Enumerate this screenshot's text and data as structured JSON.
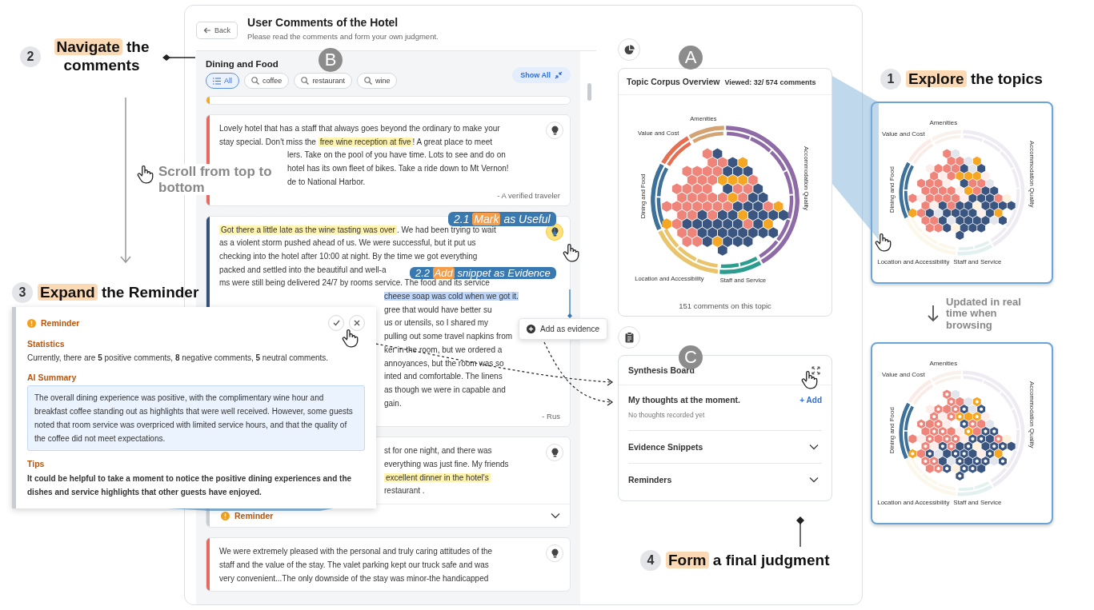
{
  "window": {
    "back_button": "Back",
    "title": "User Comments of the Hotel",
    "subtitle": "Please read the comments and form your own judgment."
  },
  "comments_panel": {
    "marker": "B",
    "title": "Dining and Food",
    "show_all": "Show All",
    "filters": [
      {
        "label": "All",
        "selected": true
      },
      {
        "label": "coffee",
        "selected": false
      },
      {
        "label": "restaurant",
        "selected": false
      },
      {
        "label": "wine",
        "selected": false
      }
    ],
    "comments": [
      {
        "kind": "stub",
        "color": "#f5a623"
      },
      {
        "kind": "comment",
        "color": "#e8695f",
        "useful": false,
        "author": "- A verified traveler",
        "lines": [
          {
            "kind": "full",
            "segments": [
              {
                "text": "Lovely hotel that has a staff that always goes beyond the ordinary to make your"
              }
            ]
          },
          {
            "kind": "full",
            "segments": [
              {
                "text": "stay special. Don't miss the "
              },
              {
                "text": "free wine reception at five",
                "kind": "highlight"
              },
              {
                "text": "! A great place to meet"
              }
            ]
          },
          {
            "kind": "fragment",
            "segments": [
              {
                "text": "lers. Take on the pool of you have time. Lots to see and do on"
              }
            ]
          },
          {
            "kind": "fragment",
            "segments": [
              {
                "text": "hotel has its own fleet of bikes. Take a ride down to Mt Vernon!"
              }
            ]
          },
          {
            "kind": "fragment",
            "segments": [
              {
                "text": "de to National Harbor."
              }
            ]
          }
        ]
      },
      {
        "kind": "comment",
        "color": "#34507c",
        "useful": true,
        "author": "- Rus",
        "lines": [
          {
            "kind": "full",
            "segments": [
              {
                "text": "Got there a little late as the wine tasting was over",
                "kind": "highlight"
              },
              {
                "text": ". We had been trying to wait"
              }
            ]
          },
          {
            "kind": "full",
            "segments": [
              {
                "text": "as a violent storm pushed ahead of us. We were successful, but it put us"
              }
            ]
          },
          {
            "kind": "full",
            "segments": [
              {
                "text": "checking into the hotel after 10:00 at night. By the time we got everything"
              }
            ]
          },
          {
            "kind": "full",
            "segments": [
              {
                "text": "packed and settled into the beautiful and well-a"
              }
            ]
          },
          {
            "kind": "full",
            "segments": [
              {
                "text": "ms were still being delivered 24/7 by rooms service. The food and its service"
              }
            ]
          },
          {
            "kind": "fragment",
            "segments": [
              {
                "text": "cheese soap was cold when we got it.",
                "kind": "selection"
              }
            ]
          },
          {
            "kind": "fragment",
            "segments": [
              {
                "text": "gree that would have better su"
              }
            ]
          },
          {
            "kind": "fragment",
            "segments": [
              {
                "text": "us or utensils, so I shared my"
              }
            ]
          },
          {
            "kind": "fragment",
            "segments": [
              {
                "text": "pulling out some travel napkins from"
              }
            ]
          },
          {
            "kind": "fragment",
            "segments": [
              {
                "text": "ker in the room, but we ordered a"
              }
            ]
          },
          {
            "kind": "fragment",
            "segments": [
              {
                "text": "annoyances, but the room was so"
              }
            ]
          },
          {
            "kind": "fragment",
            "segments": [
              {
                "text": "inted and comfortable. The linens"
              }
            ]
          },
          {
            "kind": "fragment",
            "segments": [
              {
                "text": "as though we were in capable and"
              }
            ]
          },
          {
            "kind": "fragment",
            "segments": [
              {
                "text": "gain."
              }
            ]
          }
        ]
      },
      {
        "kind": "comment",
        "useful": false,
        "reminder": {
          "label": "Reminder",
          "expanded": false
        },
        "lines": [
          {
            "kind": "fragment",
            "segments": [
              {
                "text": "st for one night, and there was"
              }
            ]
          },
          {
            "kind": "fragment",
            "segments": [
              {
                "text": "everything was just fine. My friends"
              }
            ]
          },
          {
            "kind": "fragment",
            "segments": [
              {
                "text": "excellent dinner in the hotel's",
                "kind": "highlight"
              }
            ]
          },
          {
            "kind": "fragment",
            "segments": [
              {
                "text": "restaurant ."
              }
            ]
          }
        ]
      },
      {
        "kind": "comment",
        "color": "#e8695f",
        "useful": false,
        "lines": [
          {
            "kind": "full",
            "segments": [
              {
                "text": "We were extremely pleased with the personal and truly caring attitudes of the"
              }
            ]
          },
          {
            "kind": "full",
            "segments": [
              {
                "text": "staff and the value of the stay. The valet parking kept our truck safe and was"
              }
            ]
          },
          {
            "kind": "full",
            "segments": [
              {
                "text": "very convenient...The only downside of the stay was minor-the handicapped"
              }
            ]
          }
        ]
      }
    ]
  },
  "reminder_popup": {
    "title": "Reminder",
    "statistics_heading": "Statistics",
    "statistics": "Currently, there are **5** positive comments, **8** negative comments, **5** neutral comments.",
    "summary_heading": "AI Summary",
    "summary": "The overall dining experience was positive, with the complimentary wine hour and breakfast coffee standing out as highlights that were well received. However, some guests noted that room service was overpriced with limited service hours, and that the quality of the coffee did not meet expectations.",
    "tips_heading": "Tips",
    "tips": "It could be helpful to take a moment to notice the positive dining experiences and the dishes and service highlights that other guests have enjoyed."
  },
  "evidence_menu": {
    "label": "Add as evidence"
  },
  "topic_panel": {
    "marker": "A",
    "title": "Topic Corpus Overview",
    "viewed": "Viewed: 32/ 574 comments",
    "footer": "151 comments on this topic",
    "topics": [
      {
        "name": "Amenities",
        "color": "#d4a373"
      },
      {
        "name": "Value and Cost",
        "color": "#e76f51"
      },
      {
        "name": "Accommodation Quality",
        "color": "#8e6aa6"
      },
      {
        "name": "Dining and Food",
        "color": "#3d7199"
      },
      {
        "name": "Location and Accessibility",
        "color": "#e9c46a"
      },
      {
        "name": "Staff and Service",
        "color": "#2a9d8f"
      }
    ]
  },
  "synthesis_board": {
    "marker": "C",
    "title": "Synthesis Board",
    "thoughts_heading": "My thoughts at the moment.",
    "add": "+ Add",
    "empty": "No thoughts recorded yet",
    "sections": [
      {
        "label": "Evidence Snippets",
        "expanded": false
      },
      {
        "label": "Reminders",
        "expanded": false
      }
    ]
  },
  "topic_maps": [
    {
      "show_viewed": false,
      "topics": [
        {
          "name": "Amenities",
          "selected": false
        },
        {
          "name": "Value and Cost",
          "selected": false
        },
        {
          "name": "Accommodation Quality",
          "selected": false
        },
        {
          "name": "Dining and Food",
          "selected": true
        },
        {
          "name": "Location and Accessibility",
          "selected": false
        },
        {
          "name": "Staff and Service",
          "selected": false
        }
      ]
    },
    {
      "show_viewed": true,
      "topics": [
        {
          "name": "Amenities",
          "selected": false
        },
        {
          "name": "Value and Cost",
          "selected": false
        },
        {
          "name": "Accommodation Quality",
          "selected": false
        },
        {
          "name": "Dining and Food",
          "selected": true
        },
        {
          "name": "Location and Accessibility",
          "selected": false
        },
        {
          "name": "Staff and Service",
          "selected": false
        }
      ]
    }
  ],
  "annotations": {
    "steps": [
      {
        "number": "1",
        "verb": "Explore",
        "rest": "the topics"
      },
      {
        "number": "2",
        "verb": "Navigate",
        "rest": "the comments"
      },
      {
        "number": "3",
        "verb": "Expand",
        "rest": "the Reminder"
      },
      {
        "number": "4",
        "verb": "Form",
        "rest": "a final judgment"
      }
    ],
    "substeps": [
      {
        "number": "2.1",
        "verb": "Mark",
        "rest": "as Useful"
      },
      {
        "number": "2.2",
        "verb": "Add",
        "rest": "snippet as Evidence"
      }
    ],
    "scroll_hint": "Scroll from top to bottom",
    "update_note": "Updated in real time when browsing"
  }
}
